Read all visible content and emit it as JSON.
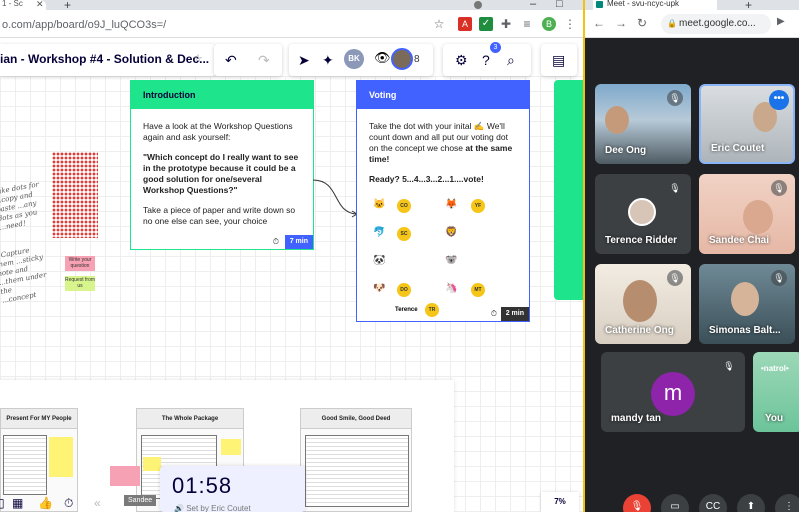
{
  "browser_left": {
    "tab_fragment": "1 - Sc",
    "tab_close": "✕",
    "new_tab": "+",
    "url": "o.com/app/board/o9J_luQCO3s=/",
    "win_controls": [
      "–",
      "□"
    ]
  },
  "miro": {
    "board_title": "ian - Workshop #4 - Solution & Dec...",
    "collaborator_initials": "BK",
    "collaborator_count": "8",
    "help_badge": "3",
    "zoom": "7%"
  },
  "intro_frame": {
    "title": "Introduction",
    "para1": "Have a look at the Workshop Questions again and ask yourself:",
    "para2": "\"Which concept do I really want to see in the prototype because it could be a good solution for one/several Workshop Questions?\"",
    "para3": "Take a piece of paper and write down so no one else can see, your choice",
    "timer": "7 min"
  },
  "voting_frame": {
    "title": "Voting",
    "para1": "Take the dot with your inital ✍️ We'll count down and all put our voting dot on the concept we chose",
    "para1_bold": "at the same time!",
    "ready": "Ready?  5...4...3...2...1....vote!",
    "voters": [
      {
        "emoji": "🐱",
        "tag": "CO"
      },
      {
        "emoji": "🦊",
        "tag": "YF"
      },
      {
        "emoji": "🐬",
        "tag": "SC"
      },
      {
        "emoji": "🦁",
        "tag": ""
      },
      {
        "emoji": "🐼",
        "tag": ""
      },
      {
        "emoji": "🐨",
        "tag": ""
      },
      {
        "emoji": "🐶",
        "tag": "DO"
      },
      {
        "emoji": "🦄",
        "tag": "MT"
      }
    ],
    "terence_label": "Terence",
    "terence_tag": "TR",
    "timer": "2 min"
  },
  "side_notes": {
    "note1": "Take dots for ...copy and paste ...any dots as you ...need!",
    "note2": "2 Capture them ...sticky note and ...them under the ...concept",
    "sticky1": "Write your question",
    "sticky2": "Request from us"
  },
  "columns": [
    "Present For MY People",
    "The Whole Package",
    "Good Smile, Good Deed"
  ],
  "bottom": {
    "sandee_label": "Sandee",
    "timer_time": "01:58",
    "timer_set_by": "Set by Eric Coutet"
  },
  "meet": {
    "tab_title": "Meet - svu-ncyc-upk",
    "url": "meet.google.co...",
    "participants": [
      {
        "name": "Dee Ong"
      },
      {
        "name": "Eric Coutet"
      },
      {
        "name": "Terence Ridder"
      },
      {
        "name": "Sandee Chai"
      },
      {
        "name": "Catherine Ong"
      },
      {
        "name": "Simonas Balt..."
      },
      {
        "name": "mandy tan",
        "initial": "m"
      },
      {
        "name": "You",
        "banner": "•natrol•"
      }
    ]
  }
}
